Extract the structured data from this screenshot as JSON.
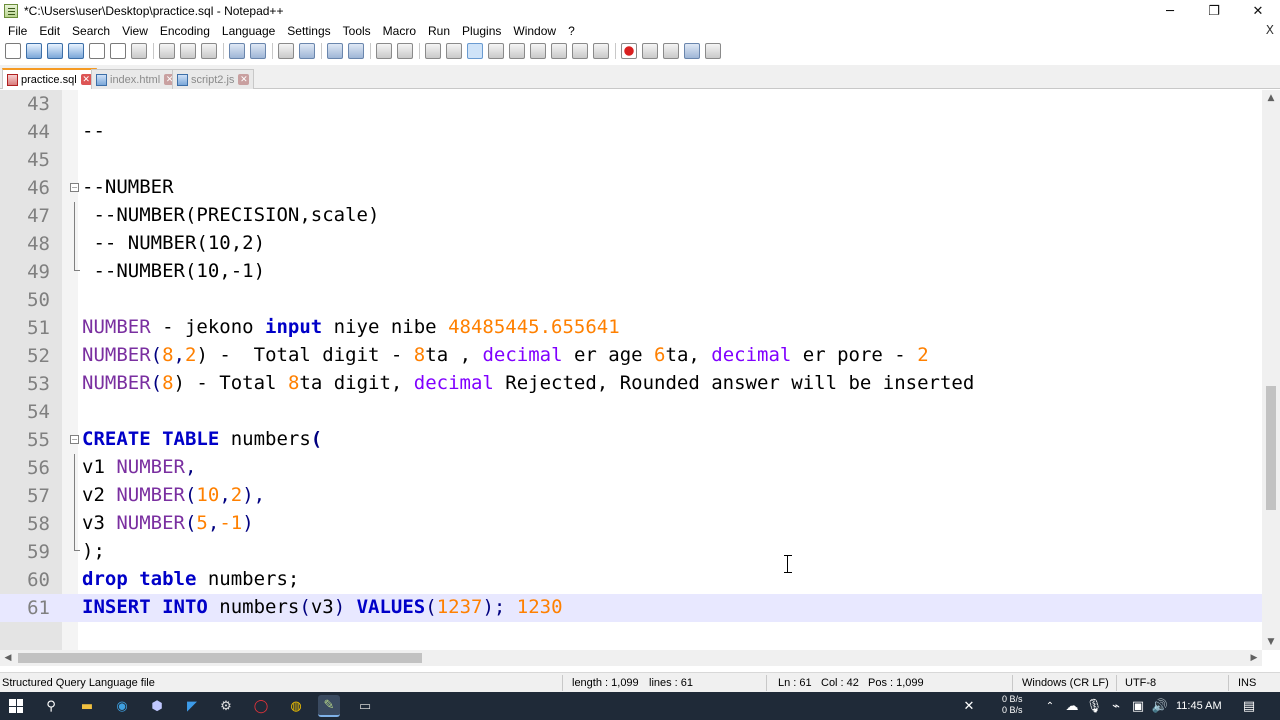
{
  "window": {
    "title": "*C:\\Users\\user\\Desktop\\practice.sql - Notepad++",
    "controls": [
      "─",
      "❐",
      "✕"
    ]
  },
  "menu": {
    "items": [
      "File",
      "Edit",
      "Search",
      "View",
      "Encoding",
      "Language",
      "Settings",
      "Tools",
      "Macro",
      "Run",
      "Plugins",
      "Window",
      "?"
    ],
    "close_label": "X"
  },
  "tabs": [
    {
      "label": "practice.sql",
      "active": true
    },
    {
      "label": "index.html",
      "active": false
    },
    {
      "label": "script2.js",
      "active": false
    }
  ],
  "editor": {
    "lines": [
      {
        "num": "43"
      },
      {
        "num": "44",
        "text": "--"
      },
      {
        "num": "45"
      },
      {
        "num": "46",
        "text": "--NUMBER"
      },
      {
        "num": "47",
        "text": " --NUMBER(PRECISION,scale)"
      },
      {
        "num": "48",
        "text": " -- NUMBER(10,2)"
      },
      {
        "num": "49",
        "text": " --NUMBER(10,-1)"
      },
      {
        "num": "50"
      },
      {
        "num": "51",
        "t1": "NUMBER",
        "t2": " - jekono ",
        "t3": "input",
        "t4": " niye nibe ",
        "t5": "48485445.655641"
      },
      {
        "num": "52",
        "t1": "NUMBER",
        "t2": "(",
        "t3": "8",
        "t4": ",",
        "t5": "2",
        "t6": ") -  Total digit - ",
        "t7": "8",
        "t8": "ta , ",
        "t9": "decimal",
        "t10": " er age ",
        "t11": "6",
        "t12": "ta, ",
        "t13": "decimal",
        "t14": " er pore - ",
        "t15": "2"
      },
      {
        "num": "53",
        "t1": "NUMBER",
        "t2": "(",
        "t3": "8",
        "t4": ") - Total ",
        "t5": "8",
        "t6": "ta digit, ",
        "t7": "decimal",
        "t8": " Rejected, Rounded answer will be inserted"
      },
      {
        "num": "54"
      },
      {
        "num": "55",
        "t1": "CREATE TABLE",
        "t2": " numbers",
        "t3": "("
      },
      {
        "num": "56",
        "t1": "v1 ",
        "t2": "NUMBER",
        "t3": ","
      },
      {
        "num": "57",
        "t1": "v2 ",
        "t2": "NUMBER",
        "t3": "(",
        "t4": "10",
        "t5": ",",
        "t6": "2",
        "t7": "),"
      },
      {
        "num": "58",
        "t1": "v3 ",
        "t2": "NUMBER",
        "t3": "(",
        "t4": "5",
        "t5": ",",
        "t6": "-1",
        "t7": ")"
      },
      {
        "num": "59",
        "t1": ");"
      },
      {
        "num": "60",
        "t1": "drop table",
        "t2": " numbers;"
      },
      {
        "num": "61",
        "t1": "INSERT INTO",
        "t2": " numbers",
        "t3": "(",
        "t4": "v3",
        "t5": ")",
        "t6": " VALUES",
        "t7": "(",
        "t8": "1237",
        "t9": ");",
        "t10": " 1230"
      }
    ]
  },
  "statusbar": {
    "language": "Structured Query Language file",
    "length": "length : 1,099",
    "lines": "lines : 61",
    "ln": "Ln : 61",
    "col": "Col : 42",
    "pos": "Pos : 1,099",
    "eol": "Windows (CR LF)",
    "encoding": "UTF-8",
    "mode": "INS"
  },
  "taskbar": {
    "net_up": "0 B/s",
    "net_down": "0 B/s",
    "time": "11:45 AM"
  },
  "colors": {
    "keyword": "#0000c8",
    "number": "#ff8000",
    "comment": "#008000",
    "type": "#7a2fa0",
    "current_line": "#e8e8ff"
  }
}
